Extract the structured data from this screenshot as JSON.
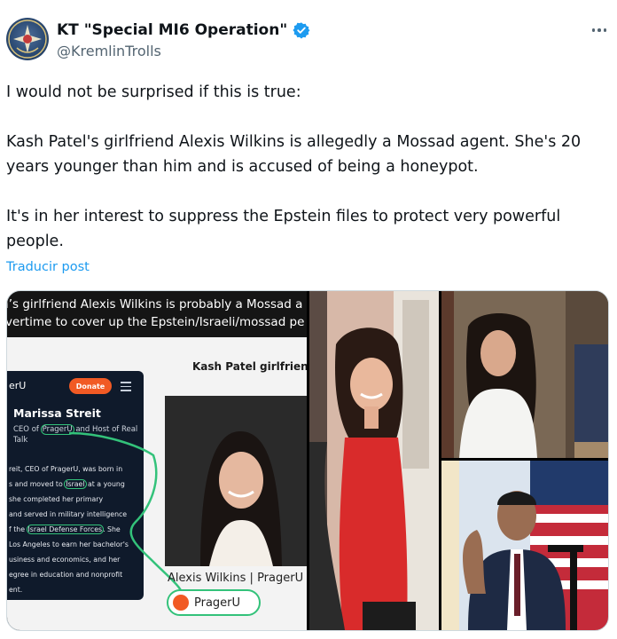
{
  "author": {
    "display_name": "KT \"Special MI6 Operation\"",
    "handle": "@KremlinTrolls",
    "avatar_icon": "emblem-avatar-icon",
    "verified_icon": "verified-badge-icon",
    "verified_color": "#1d9bf0"
  },
  "more_icon": "more-options-icon",
  "tweet": {
    "paragraphs": [
      "I would not be surprised if this is true:",
      "Kash Patel's girlfriend Alexis Wilkins is allegedly a Mossad agent. She's 20 years younger than him and is accused of being a honeypot.",
      "It's in her interest to suppress the Epstein files to protect very powerful people."
    ],
    "translate_label": "Traducir post"
  },
  "media": {
    "headline_line1": "l’s girlfriend Alexis Wilkins is probably a Mossad a",
    "headline_line2": "vertime to cover up the Epstein/Israeli/mossad pe",
    "phone": {
      "logo_text": "erU",
      "donate_label": "Donate",
      "name": "Marissa Streit",
      "title_a": "CEO of ",
      "title_b": "PragerU",
      "title_c": " and Host of Real Talk",
      "bio_lines": [
        "reit, CEO of PragerU, was born in",
        "s and moved to ",
        "Israel",
        " at a young",
        " she completed her primary",
        "and served in military intelligence",
        "f the ",
        "Israel Defense Forces",
        ". She",
        " Los Angeles to earn her bachelor's",
        "usiness and economics, and her",
        "egree in education and nonprofit",
        "ent."
      ]
    },
    "card_title": "Kash Patel girlfriend",
    "card_name": "Alexis Wilkins | PragerU",
    "prager_label": "PragerU",
    "accent_green": "#33c27a",
    "accent_orange": "#f15a24"
  }
}
